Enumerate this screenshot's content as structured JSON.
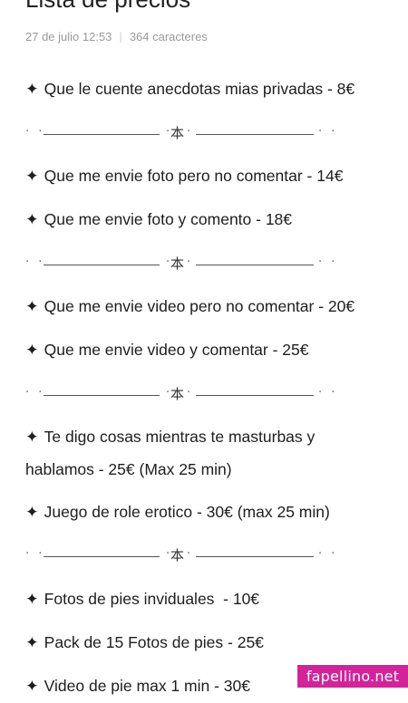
{
  "note": {
    "title": "Lista de precios",
    "date": "27 de julio 12:53",
    "meta_separator": "|",
    "chars": "364 caracteres"
  },
  "items": [
    {
      "star": "✦",
      "text": "Que le cuente anecdotas mias privadas - 8€"
    },
    {
      "star": "✦",
      "text": "Que me envie foto pero no comentar - 14€"
    },
    {
      "star": "✦",
      "text": "Que me envie foto y comento - 18€"
    },
    {
      "star": "✦",
      "text": "Que me envie video pero no comentar - 20€"
    },
    {
      "star": "✦",
      "text": "Que me envie video y comentar - 25€"
    },
    {
      "star": "✦",
      "text": "Te digo cosas mientras te masturbas y hablamos - 25€ (Max 25 min)"
    },
    {
      "star": "✦",
      "text": "Juego de role erotico - 30€ (max 25 min)"
    },
    {
      "star": "✦",
      "text": "Fotos de pies inviduales  - 10€"
    },
    {
      "star": "✦",
      "text": "Pack de 15 Fotos de pies - 25€"
    },
    {
      "star": "✦",
      "text": "Video de pie max 1 min - 30€"
    }
  ],
  "divider": {
    "dots_left": "· ·",
    "glyph": "本",
    "glyph_dot": "·",
    "dots_right": "· ·"
  },
  "watermark": "fapellino.net"
}
